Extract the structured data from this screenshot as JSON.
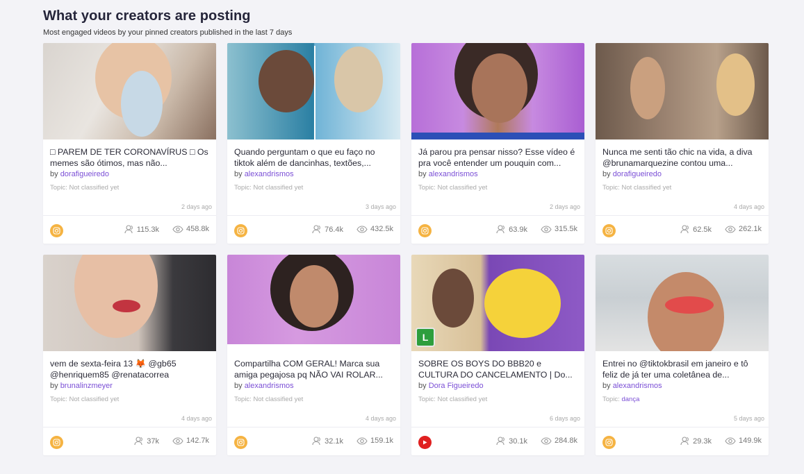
{
  "header": {
    "title": "What your creators are posting",
    "subtitle": "Most engaged videos by your pinned creators published in the last 7 days"
  },
  "colors": {
    "accent": "#7b4fd6",
    "instagram": "#f5b342",
    "youtube": "#e02020",
    "background": "#f3f3f7"
  },
  "cards": [
    {
      "description": "□ PAREM DE TER CORONAVÍRUS □ Os memes são ótimos, mas não...",
      "by_label": "by",
      "creator": "dorafigueiredo",
      "topic_label": "Topic:",
      "topic": "Not classified yet",
      "age": "2 days ago",
      "platform": "instagram-icon",
      "followers": "115.3k",
      "views": "458.8k",
      "thumb": "card1"
    },
    {
      "description": "Quando perguntam o que eu faço no tiktok além de dancinhas, textões,...",
      "by_label": "by",
      "creator": "alexandrismos",
      "topic_label": "Topic:",
      "topic": "Not classified yet",
      "age": "3 days ago",
      "platform": "instagram-icon",
      "followers": "76.4k",
      "views": "432.5k",
      "thumb": "card2"
    },
    {
      "description": "Já parou pra pensar nisso? Esse vídeo é pra você entender um pouquin com...",
      "by_label": "by",
      "creator": "alexandrismos",
      "topic_label": "Topic:",
      "topic": "Not classified yet",
      "age": "2 days ago",
      "platform": "instagram-icon",
      "followers": "63.9k",
      "views": "315.5k",
      "thumb": "card3"
    },
    {
      "description": "Nunca me senti tão chic na vida, a diva @brunamarquezine contou uma...",
      "by_label": "by",
      "creator": "dorafigueiredo",
      "topic_label": "Topic:",
      "topic": "Not classified yet",
      "age": "4 days ago",
      "platform": "instagram-icon",
      "followers": "62.5k",
      "views": "262.1k",
      "thumb": "card4"
    },
    {
      "description": "vem de sexta-feira 13 🦊 @gb65 @henriquem85 @renatacorrea",
      "by_label": "by",
      "creator": "brunalinzmeyer",
      "topic_label": "Topic:",
      "topic": "Not classified yet",
      "age": "4 days ago",
      "platform": "instagram-icon",
      "followers": "37k",
      "views": "142.7k",
      "thumb": "card5"
    },
    {
      "description": "Compartilha COM GERAL! Marca sua amiga pegajosa pq NÃO VAI ROLAR...",
      "by_label": "by",
      "creator": "alexandrismos",
      "topic_label": "Topic:",
      "topic": "Not classified yet",
      "age": "4 days ago",
      "platform": "instagram-icon",
      "followers": "32.1k",
      "views": "159.1k",
      "thumb": "card6"
    },
    {
      "description": "SOBRE OS BOYS DO BBB20 e CULTURA DO CANCELAMENTO | Do...",
      "by_label": "by",
      "creator": "Dora Figueiredo",
      "topic_label": "Topic:",
      "topic": "Not classified yet",
      "age": "6 days ago",
      "platform": "youtube-icon",
      "followers": "30.1k",
      "views": "284.8k",
      "thumb": "card7",
      "thumb_badge": "L"
    },
    {
      "description": "Entrei no @tiktokbrasil em janeiro e tô feliz de já ter uma coletânea de...",
      "by_label": "by",
      "creator": "alexandrismos",
      "topic_label": "Topic:",
      "topic": "dança",
      "topic_is_link": true,
      "age": "5 days ago",
      "platform": "instagram-icon",
      "followers": "29.3k",
      "views": "149.9k",
      "thumb": "card8"
    }
  ]
}
